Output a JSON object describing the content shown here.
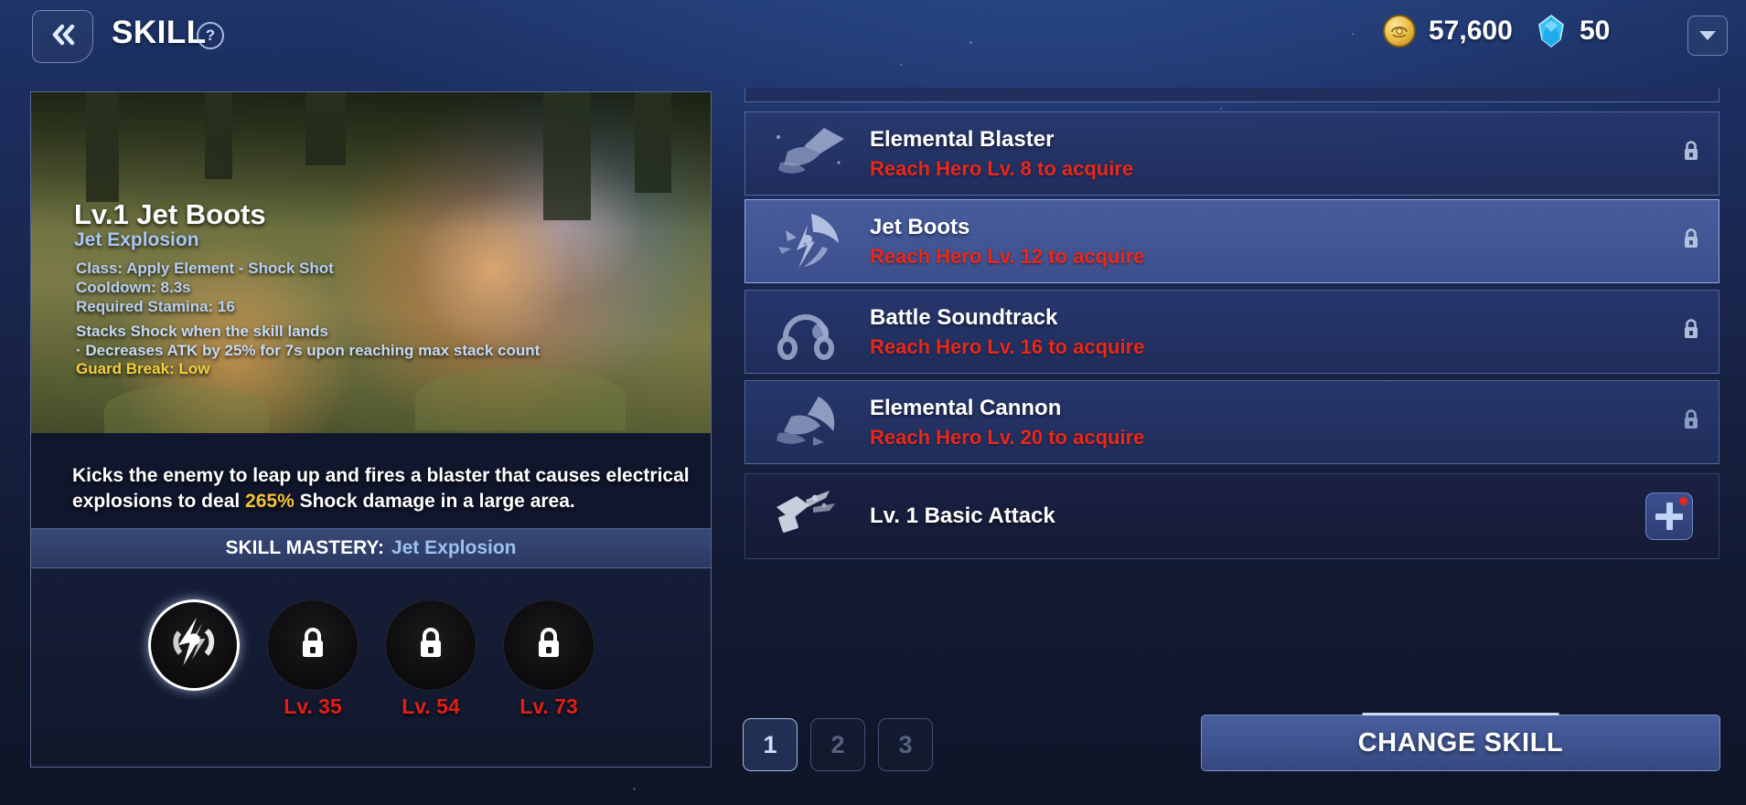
{
  "header": {
    "back_icon": "double-chevron-left-icon",
    "title": "SKILL",
    "help_icon": "?",
    "gold_icon": "gold-coin-icon",
    "gold_value": "57,600",
    "gem_icon": "blue-gem-icon",
    "gem_value": "50",
    "dropdown_icon": "chevron-down-icon"
  },
  "skill_detail": {
    "name": "Lv.1 Jet Boots",
    "subtitle": "Jet Explosion",
    "stats": [
      "Class: Apply Element - Shock Shot",
      "Cooldown: 8.3s",
      "Required Stamina: 16"
    ],
    "effects": [
      "Stacks Shock when the skill lands",
      "· Decreases ATK by 25% for 7s upon reaching max stack count"
    ],
    "guard_break": "Guard Break: Low",
    "description_prefix": "Kicks the enemy to leap up and fires a blaster that causes electrical explosions to deal ",
    "description_pct": "265%",
    "description_suffix": " Shock damage in a large area.",
    "mastery_label": "SKILL MASTERY:",
    "mastery_value": "Jet Explosion",
    "mastery_nodes": [
      {
        "state": "unlocked",
        "icon": "lightning-burst-icon",
        "level": ""
      },
      {
        "state": "locked",
        "icon": "lock-icon",
        "level": "Lv. 35"
      },
      {
        "state": "locked",
        "icon": "lock-icon",
        "level": "Lv. 54"
      },
      {
        "state": "locked",
        "icon": "lock-icon",
        "level": "Lv. 73"
      }
    ]
  },
  "skill_list": [
    {
      "name": "Elemental Blaster",
      "requirement": "Reach Hero Lv. 8 to acquire",
      "icon": "blaster-icon",
      "locked": true,
      "selected": false,
      "style": "normal"
    },
    {
      "name": "Jet Boots",
      "requirement": "Reach Hero Lv. 12 to acquire",
      "icon": "jet-boots-icon",
      "locked": true,
      "selected": true,
      "style": "normal"
    },
    {
      "name": "Battle Soundtrack",
      "requirement": "Reach Hero Lv. 16 to acquire",
      "icon": "headphones-icon",
      "locked": true,
      "selected": false,
      "style": "normal"
    },
    {
      "name": "Elemental Cannon",
      "requirement": "Reach Hero Lv. 20 to acquire",
      "icon": "cannon-icon",
      "locked": true,
      "selected": false,
      "style": "normal"
    },
    {
      "name": "Lv. 1 Basic Attack",
      "requirement": "",
      "icon": "basic-attack-icon",
      "locked": false,
      "selected": false,
      "style": "dark"
    }
  ],
  "footer": {
    "pages": [
      {
        "label": "1",
        "active": true
      },
      {
        "label": "2",
        "active": false
      },
      {
        "label": "3",
        "active": false
      }
    ],
    "change_skill_label": "CHANGE SKILL",
    "add_icon": "plus-icon"
  },
  "colors": {
    "accent_red": "#e8281b",
    "accent_gold": "#f5c33b",
    "accent_blue": "#9cc0ef",
    "selected_row": "#4a5ea0",
    "panel_bg": "#202d5c"
  }
}
